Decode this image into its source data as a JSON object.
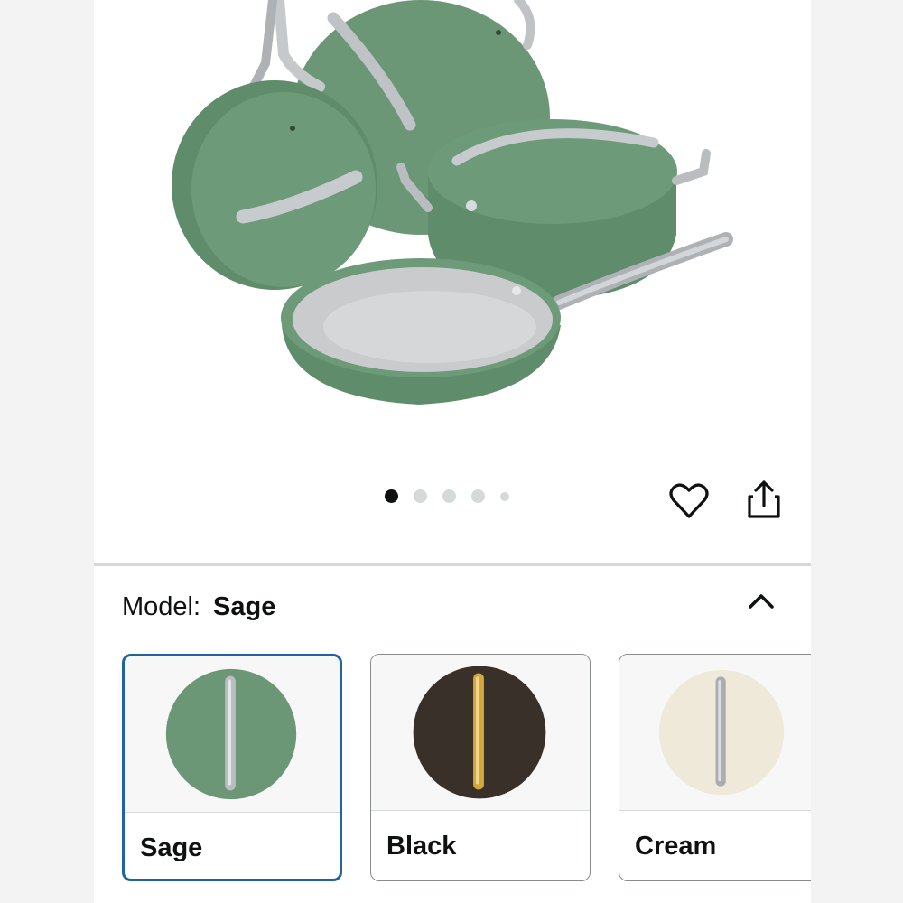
{
  "product_gallery": {
    "image_icon": "cookware-set-photo",
    "carousel_dots": 5,
    "active_dot": 0,
    "colors": {
      "sage": "#6b9777",
      "sage_dark": "#4f7a5a",
      "interior": "#c9cbcc",
      "steel": "#b9bdc0"
    }
  },
  "actions": {
    "favorite_icon": "heart-icon",
    "share_icon": "share-icon"
  },
  "variation": {
    "label": "Model:",
    "selected_value": "Sage",
    "collapse_icon": "chevron-up-icon",
    "options": [
      {
        "name": "Sage",
        "color": "#6b9777",
        "handle": "#b9bdc0",
        "selected": true
      },
      {
        "name": "Black",
        "color": "#3a302a",
        "handle": "#d4a73b",
        "selected": false
      },
      {
        "name": "Cream",
        "color": "#efe9d9",
        "handle": "#a9adb0",
        "selected": false
      }
    ]
  },
  "theme": {
    "selected_border": "#2162a1",
    "text": "#0f1111"
  }
}
